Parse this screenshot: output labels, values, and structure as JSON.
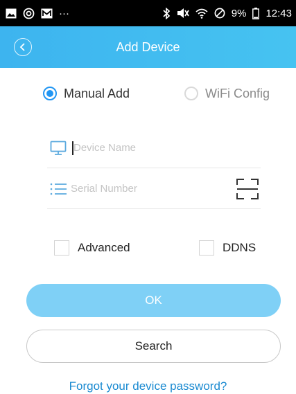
{
  "status_bar": {
    "more_label": "···",
    "battery_text": "9%",
    "time": "12:43",
    "left_icons": [
      "gallery-icon",
      "sync-icon",
      "mail-icon"
    ],
    "right_icons": [
      "bluetooth-icon",
      "mute-icon",
      "wifi-icon",
      "blocked-icon",
      "battery-icon"
    ]
  },
  "header": {
    "title": "Add Device",
    "back_icon": "chevron-left-icon",
    "background_color": "#3db4ef"
  },
  "mode": {
    "manual_label": "Manual Add",
    "wifi_label": "WiFi Config",
    "selected": "manual",
    "accent_color": "#2196f3"
  },
  "fields": {
    "device_name": {
      "placeholder": "Device Name",
      "value": "",
      "icon": "monitor-icon"
    },
    "serial_number": {
      "placeholder": "Serial Number",
      "value": "",
      "icon": "list-icon",
      "scan_icon": "scan-qr-icon"
    }
  },
  "options": {
    "advanced_label": "Advanced",
    "advanced_checked": false,
    "ddns_label": "DDNS",
    "ddns_checked": false
  },
  "buttons": {
    "ok_label": "OK",
    "ok_color": "#7fd0f6",
    "search_label": "Search"
  },
  "links": {
    "forgot_password": "Forgot your device password?",
    "link_color": "#1a8ad1"
  }
}
